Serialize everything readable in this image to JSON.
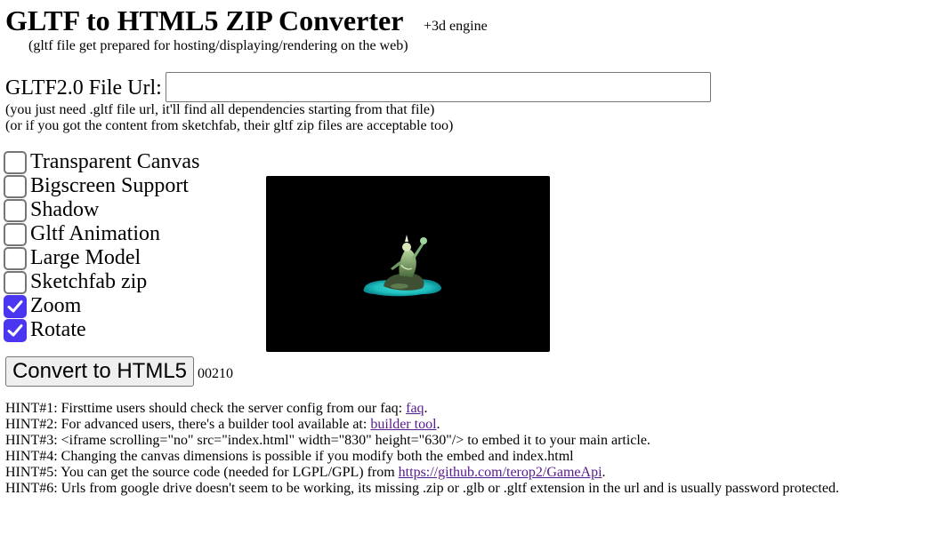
{
  "header": {
    "title": "GLTF to HTML5 ZIP Converter",
    "engine_note": "+3d engine",
    "subtitle": "(gltf file get prepared for hosting/displaying/rendering on the web)"
  },
  "url_field": {
    "label": "GLTF2.0 File Url:",
    "value": "",
    "note1": "(you just need .gltf file url, it'll find all dependencies starting from that file)",
    "note2": "(or if you got the content from sketchfab, their gltf zip files are acceptable too)"
  },
  "options": [
    {
      "label": "Transparent Canvas",
      "checked": false
    },
    {
      "label": "Bigscreen Support",
      "checked": false
    },
    {
      "label": "Shadow",
      "checked": false
    },
    {
      "label": "Gltf Animation",
      "checked": false
    },
    {
      "label": "Large Model",
      "checked": false
    },
    {
      "label": "Sketchfab zip",
      "checked": false
    },
    {
      "label": "Zoom",
      "checked": true
    },
    {
      "label": "Rotate",
      "checked": true
    }
  ],
  "preview": {
    "background": "#000000",
    "icon": "3d-model-preview"
  },
  "convert": {
    "label": "Convert to HTML5",
    "counter": "00210"
  },
  "hints": {
    "h1_text": "HINT#1: Firsttime users should check the server config from our faq: ",
    "h1_link": "faq",
    "h1_end": ".",
    "h2_text": "HINT#2: For advanced users, there's a builder tool available at: ",
    "h2_link": "builder tool",
    "h2_end": ".",
    "h3_text": "HINT#3: <iframe scrolling=\"no\" src=\"index.html\" width=\"830\" height=\"630\"/> to embed it to your main article.",
    "h4_text": "HINT#4: Changing the canvas dimensions is possible if you modify both the embed and index.html",
    "h5_text": "HINT#5: You can get the source code (needed for LGPL/GPL) from ",
    "h5_link": "https://github.com/terop2/GameApi",
    "h5_end": ".",
    "h6_text": "HINT#6: Urls from google drive doesn't seem to be working, its missing .zip or .glb or .gltf extension in the url and is usually password protected."
  },
  "colors": {
    "checkbox_checked": "#4a36f0",
    "link_visited": "#551a8b",
    "button_bg": "#efefef"
  }
}
